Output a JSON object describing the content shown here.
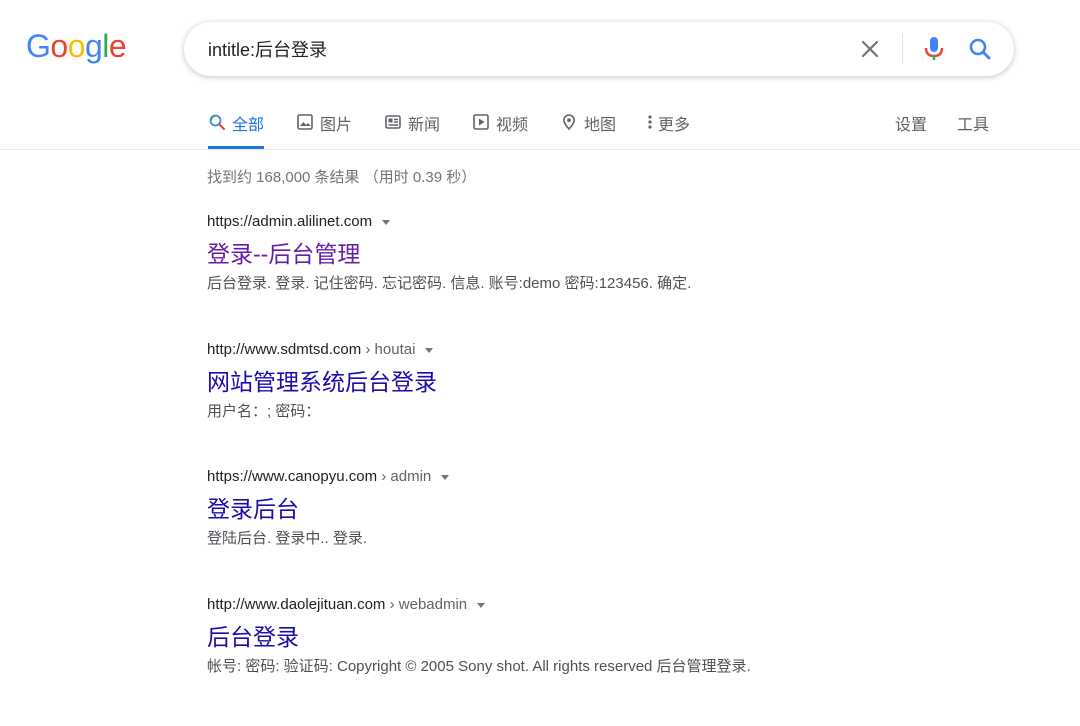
{
  "logo": {
    "letters": [
      "G",
      "o",
      "o",
      "g",
      "l",
      "e"
    ],
    "colors": [
      "#4285f4",
      "#ea4335",
      "#fbbc05",
      "#4285f4",
      "#34a853",
      "#ea4335"
    ]
  },
  "search": {
    "query": "intitle:后台登录"
  },
  "tabs": [
    {
      "label": "全部",
      "icon": "search-icon",
      "active": true
    },
    {
      "label": "图片",
      "icon": "image-icon"
    },
    {
      "label": "新闻",
      "icon": "news-icon"
    },
    {
      "label": "视频",
      "icon": "video-icon"
    },
    {
      "label": "地图",
      "icon": "map-pin-icon"
    },
    {
      "label": "更多",
      "icon": "more-vert-icon"
    }
  ],
  "tools": {
    "settings_label": "设置",
    "tools_label": "工具"
  },
  "result_stats": "找到约 168,000 条结果 （用时 0.39 秒）",
  "results": [
    {
      "url": "https://admin.alilinet.com",
      "crumb": "",
      "title": "登录--后台管理",
      "visited": true,
      "snippet": "后台登录. 登录. 记住密码. 忘记密码. 信息. 账号:demo 密码:123456. 确定."
    },
    {
      "url": "http://www.sdmtsd.com",
      "crumb": " › houtai",
      "title": "网站管理系统后台登录",
      "visited": false,
      "snippet": "用户名：; 密码："
    },
    {
      "url": "https://www.canopyu.com",
      "crumb": " › admin",
      "title": "登录后台",
      "visited": false,
      "snippet": "登陆后台. 登录中.. 登录."
    },
    {
      "url": "http://www.daolejituan.com",
      "crumb": " › webadmin",
      "title": "后台登录",
      "visited": false,
      "snippet": "帐号: 密码: 验证码: Copyright © 2005 Sony shot. All rights reserved 后台管理登录."
    }
  ],
  "colors": {
    "accent": "#1a73e8",
    "link": "#1a0dab",
    "visited": "#681da8"
  }
}
